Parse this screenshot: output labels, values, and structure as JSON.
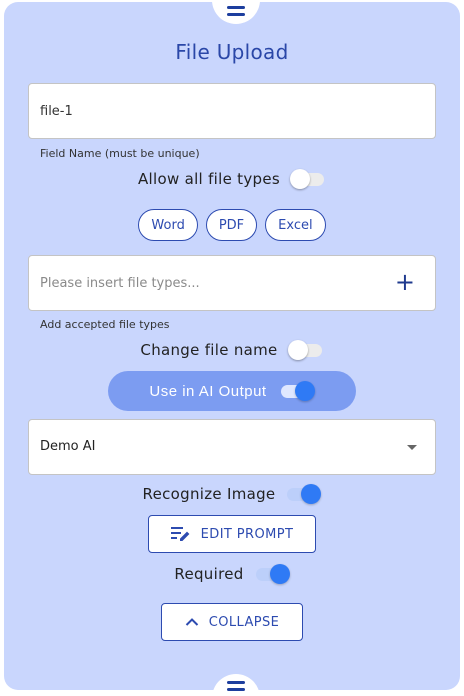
{
  "title": "File Upload",
  "field_name": {
    "value": "file-1",
    "helper": "Field Name (must be unique)"
  },
  "allow_all": {
    "label": "Allow all file types",
    "on": false
  },
  "file_type_chips": [
    "Word",
    "PDF",
    "Excel"
  ],
  "file_types_input": {
    "placeholder": "Please insert file types...",
    "helper": "Add accepted file types",
    "add_icon": "plus-icon"
  },
  "change_file_name": {
    "label": "Change file name",
    "on": false
  },
  "ai_output": {
    "label": "Use in AI Output",
    "on": true
  },
  "ai_select": {
    "value": "Demo AI",
    "icon": "chevron-down-icon"
  },
  "recognize_image": {
    "label": "Recognize Image",
    "on": true
  },
  "edit_prompt": {
    "label": "EDIT PROMPT",
    "icon": "edit-prompt-icon"
  },
  "required": {
    "label": "Required",
    "on": true
  },
  "collapse": {
    "label": "COLLAPSE",
    "icon": "chevron-up-icon"
  },
  "colors": {
    "panel": "#c9d6fd",
    "accent": "#2d4bb0",
    "title": "#2a47a8",
    "switch_on": "#2f7af5",
    "ai_button": "#7c9cf1"
  },
  "drag_handle_icon": "menu-icon"
}
